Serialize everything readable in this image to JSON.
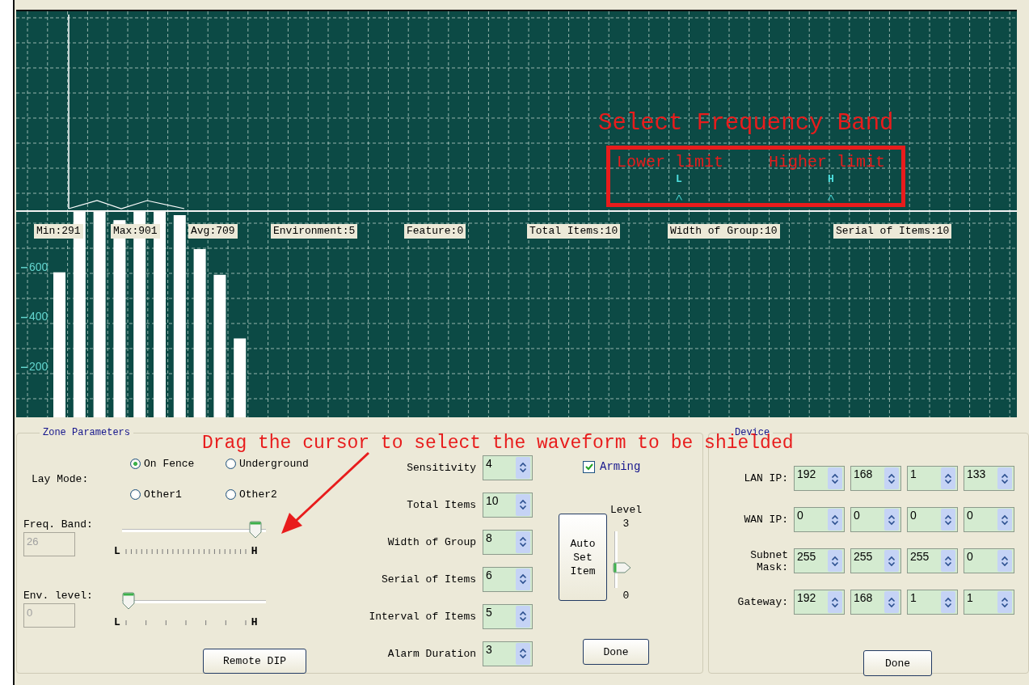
{
  "waveform": {
    "annotation": {
      "title": "Select Frequency Band",
      "lower_label": "Lower limit",
      "higher_label": "Higher limit",
      "lower_marker": "L",
      "higher_marker": "H"
    }
  },
  "histogram": {
    "stats": [
      "Min:291",
      "Max:901",
      "Avg:709",
      "Environment:5",
      "Feature:0",
      "Total Items:10",
      "Width of Group:10",
      "Serial of Items:10"
    ],
    "axis_labels": [
      "600",
      "400",
      "200"
    ]
  },
  "instruction": "Drag the cursor to select the waveform to be shielded",
  "zone_parameters": {
    "title": "Zone Parameters",
    "lay_mode": {
      "label": "Lay Mode:",
      "options": [
        {
          "label": "On Fence",
          "selected": true
        },
        {
          "label": "Underground",
          "selected": false
        },
        {
          "label": "Other1",
          "selected": false
        },
        {
          "label": "Other2",
          "selected": false
        }
      ]
    },
    "freq_band": {
      "label": "Freq. Band:",
      "value": "26",
      "disabled": true,
      "level": 0.97,
      "low": "L",
      "high": "H"
    },
    "env_level": {
      "label": "Env. level:",
      "value": "0",
      "disabled": true,
      "level": 0,
      "low": "L",
      "high": "H"
    },
    "remote_button": "Remote DIP",
    "fields": [
      {
        "label": "Sensitivity",
        "value": "4"
      },
      {
        "label": "Total Items",
        "value": "10"
      },
      {
        "label": "Width of Group",
        "value": "8"
      },
      {
        "label": "Serial of Items",
        "value": "6"
      },
      {
        "label": "Interval of Items",
        "value": "5"
      },
      {
        "label": "Alarm Duration",
        "value": "3"
      }
    ],
    "arming": {
      "label": "Arming",
      "checked": true
    },
    "auto_button": "Auto Set Item",
    "level_slider": {
      "label": "Level",
      "max": "3",
      "min": "0",
      "level": 0.33
    },
    "done_button": "Done"
  },
  "device": {
    "title": "Device",
    "rows": [
      {
        "label": "LAN IP:",
        "values": [
          "192",
          "168",
          "1",
          "133"
        ]
      },
      {
        "label": "WAN IP:",
        "values": [
          "0",
          "0",
          "0",
          "0"
        ]
      },
      {
        "label": "Subnet Mask:",
        "values": [
          "255",
          "255",
          "255",
          "0"
        ]
      },
      {
        "label": "Gateway:",
        "values": [
          "192",
          "168",
          "1",
          "1"
        ]
      }
    ],
    "done_button": "Done"
  }
}
